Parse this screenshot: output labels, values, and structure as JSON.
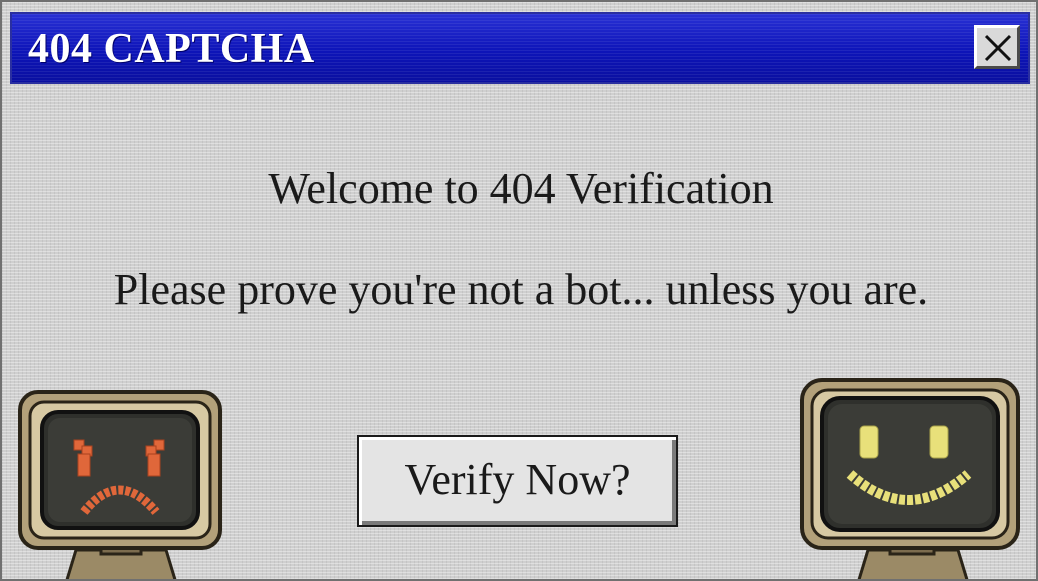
{
  "window": {
    "title": "404 CAPTCHA",
    "close_icon": "close-icon"
  },
  "main": {
    "heading": "Welcome to 404 Verification",
    "message": "Please prove you're not a bot... unless you are.",
    "verify_button_label": "Verify Now?"
  },
  "illustrations": {
    "left_monitor": {
      "icon": "sad-monitor-icon",
      "face_color": "#e0673a"
    },
    "right_monitor": {
      "icon": "happy-monitor-icon",
      "face_color": "#e8e07a"
    }
  },
  "colors": {
    "titlebar": "#0d14b8",
    "window_bg": "#cfcfcf",
    "text": "#1a1a1a"
  }
}
